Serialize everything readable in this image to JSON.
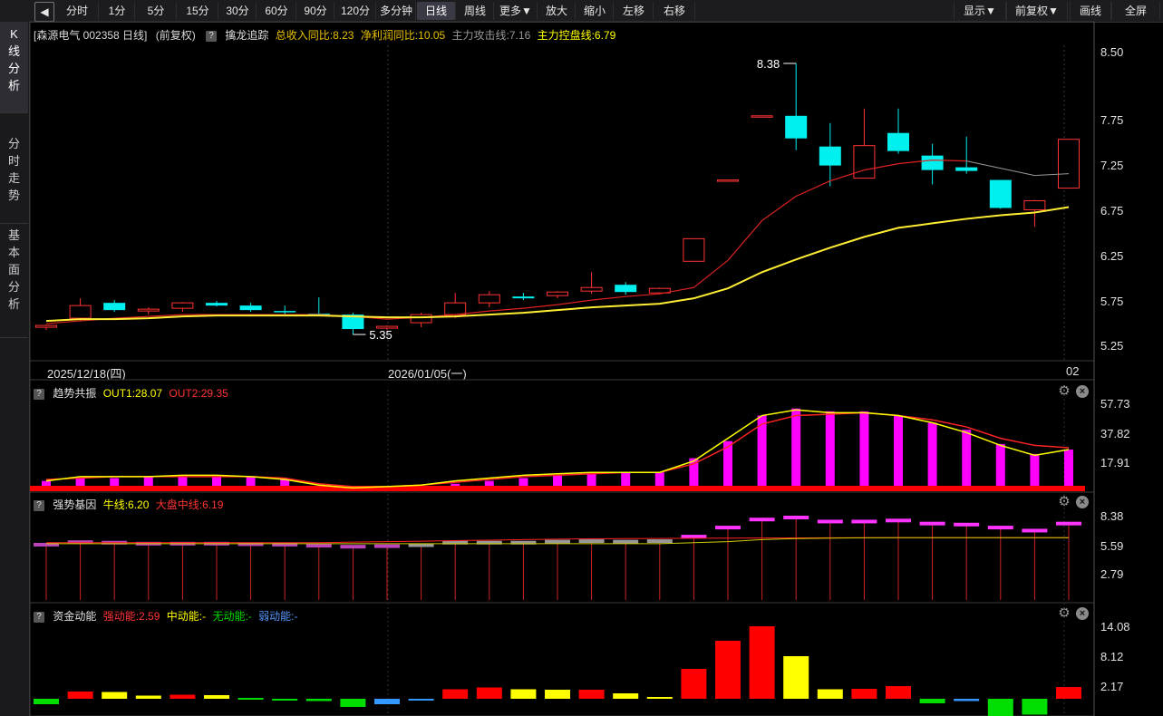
{
  "toolbar": {
    "back_icon": "back-arrow-icon",
    "buttons": [
      "分时",
      "1分",
      "5分",
      "15分",
      "30分",
      "60分",
      "90分",
      "120分",
      "多分钟",
      "日线",
      "周线",
      "更多▼",
      "放大",
      "缩小",
      "左移",
      "右移"
    ],
    "active": "日线",
    "right_buttons": [
      "显示▼",
      "前复权▼",
      "画线",
      "全屏"
    ]
  },
  "side_tabs": [
    "K线分析",
    "分时走势",
    "基本面分析"
  ],
  "main": {
    "stock_label": "[森源电气 002358 日线]",
    "adjust_label": "(前复权)",
    "indicator_name": "擒龙追踪",
    "items": [
      "总收入同比:8.23",
      "净利润同比:10.05",
      "主力攻击线:7.16",
      "主力控盘线:6.79"
    ],
    "item_colors": [
      "#e8c000",
      "#e8c000",
      "#999999",
      "#ffff00"
    ],
    "y_ticks": [
      "8.50",
      "7.75",
      "7.25",
      "6.75",
      "6.25",
      "5.75",
      "5.25"
    ],
    "high_label": "8.38",
    "low_label": "5.35",
    "date_left": "2025/12/18(四)",
    "date_mid": "2026/01/05(一)",
    "date_right": "02"
  },
  "pane2": {
    "name": "趋势共振",
    "out1": "OUT1:28.07",
    "out2": "OUT2:29.35",
    "y_ticks": [
      "57.73",
      "37.82",
      "17.91"
    ]
  },
  "pane3": {
    "name": "强势基因",
    "bull": "牛线:6.20",
    "market": "大盘中线:6.19",
    "y_ticks": [
      "8.38",
      "5.59",
      "2.79"
    ]
  },
  "pane4": {
    "name": "资金动能",
    "strong": "强动能:2.59",
    "mid": "中动能:-",
    "none": "无动能:-",
    "weak": "弱动能:-",
    "y_ticks": [
      "14.08",
      "8.12",
      "2.17"
    ]
  },
  "chart_data": [
    {
      "type": "candlestick",
      "title": "森源电气 002358 日线",
      "ylim": [
        5.2,
        8.55
      ],
      "candles": [
        {
          "o": 5.46,
          "h": 5.49,
          "l": 5.43,
          "c": 5.48,
          "col": "up"
        },
        {
          "o": 5.56,
          "h": 5.78,
          "l": 5.53,
          "c": 5.7,
          "col": "up"
        },
        {
          "o": 5.73,
          "h": 5.76,
          "l": 5.63,
          "c": 5.65,
          "col": "down"
        },
        {
          "o": 5.64,
          "h": 5.68,
          "l": 5.6,
          "c": 5.66,
          "col": "up"
        },
        {
          "o": 5.67,
          "h": 5.74,
          "l": 5.63,
          "c": 5.73,
          "col": "up"
        },
        {
          "o": 5.73,
          "h": 5.75,
          "l": 5.69,
          "c": 5.7,
          "col": "down"
        },
        {
          "o": 5.7,
          "h": 5.73,
          "l": 5.63,
          "c": 5.65,
          "col": "down"
        },
        {
          "o": 5.64,
          "h": 5.7,
          "l": 5.6,
          "c": 5.63,
          "col": "down"
        },
        {
          "o": 5.61,
          "h": 5.79,
          "l": 5.58,
          "c": 5.59,
          "col": "down"
        },
        {
          "o": 5.6,
          "h": 5.62,
          "l": 5.38,
          "c": 5.44,
          "col": "down"
        },
        {
          "o": 5.45,
          "h": 5.48,
          "l": 5.43,
          "c": 5.47,
          "col": "up"
        },
        {
          "o": 5.51,
          "h": 5.62,
          "l": 5.46,
          "c": 5.6,
          "col": "up"
        },
        {
          "o": 5.6,
          "h": 5.84,
          "l": 5.56,
          "c": 5.73,
          "col": "up"
        },
        {
          "o": 5.73,
          "h": 5.86,
          "l": 5.68,
          "c": 5.82,
          "col": "up"
        },
        {
          "o": 5.8,
          "h": 5.84,
          "l": 5.76,
          "c": 5.78,
          "col": "down"
        },
        {
          "o": 5.81,
          "h": 5.86,
          "l": 5.78,
          "c": 5.85,
          "col": "up"
        },
        {
          "o": 5.86,
          "h": 6.07,
          "l": 5.83,
          "c": 5.9,
          "col": "up"
        },
        {
          "o": 5.93,
          "h": 5.96,
          "l": 5.82,
          "c": 5.85,
          "col": "down"
        },
        {
          "o": 5.84,
          "h": 5.9,
          "l": 5.83,
          "c": 5.89,
          "col": "up"
        },
        {
          "o": 6.19,
          "h": 6.44,
          "l": 6.19,
          "c": 6.44,
          "col": "up"
        },
        {
          "o": 7.09,
          "h": 7.09,
          "l": 7.09,
          "c": 7.09,
          "col": "up"
        },
        {
          "o": 7.8,
          "h": 7.8,
          "l": 7.8,
          "c": 7.8,
          "col": "up"
        },
        {
          "o": 7.8,
          "h": 8.38,
          "l": 7.42,
          "c": 7.55,
          "col": "down"
        },
        {
          "o": 7.46,
          "h": 7.72,
          "l": 7.02,
          "c": 7.25,
          "col": "down"
        },
        {
          "o": 7.11,
          "h": 7.88,
          "l": 7.11,
          "c": 7.47,
          "col": "up"
        },
        {
          "o": 7.61,
          "h": 7.88,
          "l": 7.38,
          "c": 7.41,
          "col": "down"
        },
        {
          "o": 7.36,
          "h": 7.49,
          "l": 7.04,
          "c": 7.2,
          "col": "down"
        },
        {
          "o": 7.23,
          "h": 7.57,
          "l": 7.16,
          "c": 7.19,
          "col": "down"
        },
        {
          "o": 7.09,
          "h": 7.09,
          "l": 6.77,
          "c": 6.78,
          "col": "down"
        },
        {
          "o": 6.76,
          "h": 6.87,
          "l": 6.57,
          "c": 6.86,
          "col": "up"
        },
        {
          "o": 7.0,
          "h": 7.54,
          "l": 7.0,
          "c": 7.54,
          "col": "up"
        }
      ],
      "ma_red": [
        5.5,
        5.53,
        5.56,
        5.58,
        5.6,
        5.6,
        5.6,
        5.6,
        5.6,
        5.58,
        5.55,
        5.57,
        5.6,
        5.64,
        5.67,
        5.71,
        5.76,
        5.8,
        5.83,
        5.9,
        6.2,
        6.64,
        6.91,
        7.08,
        7.2,
        7.27,
        7.31,
        7.3,
        7.22,
        7.14,
        7.16
      ],
      "ma_yellow": [
        5.53,
        5.55,
        5.55,
        5.56,
        5.58,
        5.59,
        5.59,
        5.59,
        5.59,
        5.58,
        5.57,
        5.57,
        5.58,
        5.6,
        5.62,
        5.65,
        5.68,
        5.7,
        5.72,
        5.78,
        5.89,
        6.07,
        6.21,
        6.34,
        6.46,
        6.56,
        6.61,
        6.66,
        6.7,
        6.73,
        6.79
      ]
    },
    {
      "type": "bar",
      "title": "趋势共振",
      "ylim": [
        0,
        65
      ],
      "values": [
        6,
        8,
        8,
        9,
        10,
        10,
        9,
        8,
        0,
        0,
        0,
        0,
        4,
        6,
        8,
        10,
        12,
        12,
        12,
        22,
        34,
        52,
        57,
        55,
        55,
        52,
        47,
        42,
        32,
        25,
        28.07
      ],
      "out1": [
        6,
        9,
        9,
        9,
        10,
        10,
        9,
        7,
        3,
        1,
        2,
        3,
        6,
        8,
        10,
        11,
        12,
        12,
        12,
        20,
        36,
        52,
        56,
        54,
        54,
        52,
        47,
        40,
        31,
        24,
        28.07
      ],
      "out2": [
        7,
        8,
        9,
        9,
        9,
        9,
        9,
        8,
        4,
        2,
        2,
        3,
        5,
        7,
        9,
        10,
        11,
        12,
        12,
        18,
        30,
        46,
        52,
        53,
        54,
        52,
        49,
        44,
        36,
        31,
        29.35
      ]
    },
    {
      "type": "bar",
      "title": "强势基因",
      "ylim": [
        0,
        9
      ],
      "values": [
        5.5,
        5.75,
        5.7,
        5.6,
        5.6,
        5.6,
        5.55,
        5.5,
        5.4,
        5.3,
        5.35,
        5.45,
        5.7,
        5.7,
        5.7,
        5.8,
        5.85,
        5.8,
        5.85,
        6.3,
        7.2,
        8.0,
        8.2,
        7.8,
        7.8,
        7.9,
        7.6,
        7.5,
        7.2,
        6.9,
        7.6
      ],
      "bull": [
        5.6,
        5.6,
        5.6,
        5.6,
        5.6,
        5.6,
        5.6,
        5.6,
        5.6,
        5.6,
        5.6,
        5.6,
        5.6,
        5.6,
        5.6,
        5.6,
        5.6,
        5.6,
        5.6,
        5.7,
        5.8,
        6.0,
        6.1,
        6.15,
        6.18,
        6.2,
        6.2,
        6.2,
        6.2,
        6.2,
        6.2
      ],
      "market": [
        5.7,
        5.7,
        5.7,
        5.7,
        5.7,
        5.7,
        5.7,
        5.7,
        5.7,
        5.75,
        5.8,
        5.85,
        5.9,
        5.95,
        6.0,
        6.05,
        6.08,
        6.1,
        6.12,
        6.14,
        6.15,
        6.16,
        6.17,
        6.18,
        6.19,
        6.2,
        6.2,
        6.2,
        6.2,
        6.19,
        6.19
      ]
    },
    {
      "type": "bar",
      "title": "资金动能",
      "ylim": [
        -3,
        16
      ],
      "values": [
        -1.2,
        1.6,
        1.5,
        0.7,
        0.9,
        0.8,
        0.2,
        -0.4,
        -0.5,
        -1.8,
        -1.2,
        -0.2,
        2.1,
        2.5,
        2.1,
        2.0,
        2.0,
        1.2,
        0.4,
        6.6,
        12.8,
        16.0,
        9.4,
        2.1,
        2.2,
        2.8,
        -1.0,
        -0.5,
        -3.8,
        -3.5,
        2.59
      ],
      "bar_colors": [
        "#00dd00",
        "#ff0000",
        "#ffff00",
        "#ffff00",
        "#ff0000",
        "#ffff00",
        "#00dd00",
        "#00dd00",
        "#00dd00",
        "#00dd00",
        "#3399ff",
        "#3399ff",
        "#ff0000",
        "#ff0000",
        "#ffff00",
        "#ffff00",
        "#ff0000",
        "#ffff00",
        "#ffff00",
        "#ff0000",
        "#ff0000",
        "#ff0000",
        "#ffff00",
        "#ffff00",
        "#ff0000",
        "#ff0000",
        "#00dd00",
        "#3399ff",
        "#00dd00",
        "#00dd00",
        "#ff0000"
      ]
    }
  ]
}
